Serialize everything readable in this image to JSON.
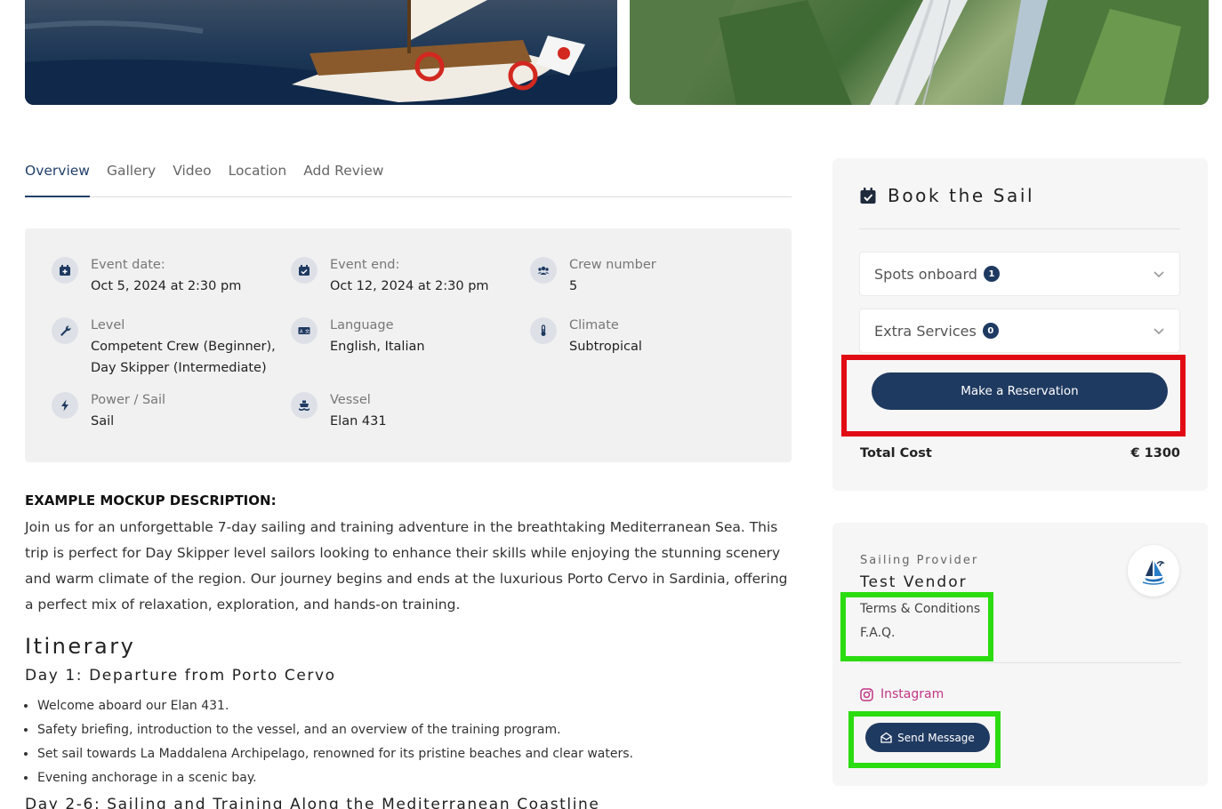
{
  "tabs": [
    "Overview",
    "Gallery",
    "Video",
    "Location",
    "Add Review"
  ],
  "details": {
    "event_date": {
      "label": "Event date:",
      "value": "Oct 5, 2024 at 2:30 pm"
    },
    "event_end": {
      "label": "Event end:",
      "value": "Oct 12, 2024 at 2:30 pm"
    },
    "crew_number": {
      "label": "Crew number",
      "value": "5"
    },
    "level": {
      "label": "Level",
      "value_line1": "Competent Crew (Beginner),",
      "value_line2": "Day Skipper (Intermediate)"
    },
    "language": {
      "label": "Language",
      "value": "English, Italian"
    },
    "climate": {
      "label": "Climate",
      "value": "Subtropical"
    },
    "power_sail": {
      "label": "Power / Sail",
      "value": "Sail"
    },
    "vessel": {
      "label": "Vessel",
      "value": "Elan 431"
    }
  },
  "description": {
    "title": "EXAMPLE MOCKUP DESCRIPTION:",
    "body": "Join us for an unforgettable 7-day sailing and training adventure in the breathtaking Mediterranean Sea. This trip is perfect for Day Skipper level sailors looking to enhance their skills while enjoying the stunning scenery and warm climate of the region. Our journey begins and ends at the luxurious Porto Cervo in Sardinia, offering a perfect mix of relaxation, exploration, and hands-on training."
  },
  "itinerary": {
    "title": "Itinerary",
    "day1_title": "Day 1: Departure from Porto Cervo",
    "day1_items": [
      "Welcome aboard our Elan 431.",
      "Safety briefing, introduction to the vessel, and an overview of the training program.",
      "Set sail towards La Maddalena Archipelago, renowned for its pristine beaches and clear waters.",
      "Evening anchorage in a scenic bay."
    ],
    "day2_title": "Day 2-6: Sailing and Training Along the Mediterranean Coastline"
  },
  "booking": {
    "title": "Book the Sail",
    "spots_label": "Spots onboard",
    "spots_count": "1",
    "extras_label": "Extra Services",
    "extras_count": "0",
    "reserve_label": "Make a Reservation",
    "total_label": "Total Cost",
    "total_value": "€ 1300"
  },
  "provider": {
    "label": "Sailing Provider",
    "name": "Test Vendor",
    "terms": "Terms & Conditions",
    "faq": "F.A.Q.",
    "instagram": "Instagram",
    "message": "Send Message"
  },
  "colors": {
    "primary": "#1f3a61",
    "highlight_red": "#e10b14",
    "highlight_green": "#2bdc10",
    "instagram": "#c13584"
  }
}
